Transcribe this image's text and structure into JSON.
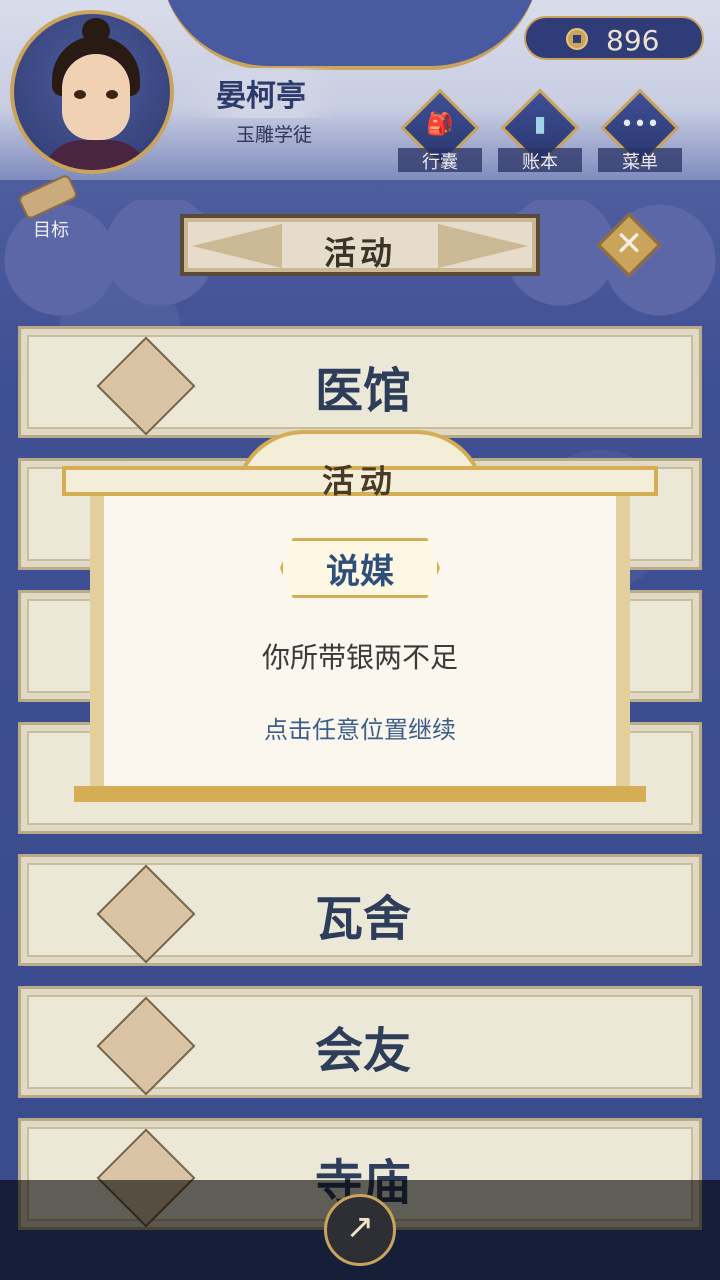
{
  "header": {
    "player_name": "晏柯亭",
    "player_rank": "玉雕学徒",
    "coins": "896",
    "buttons": [
      {
        "label": "行囊",
        "icon": "bag-icon"
      },
      {
        "label": "账本",
        "icon": "ledger-icon"
      },
      {
        "label": "菜单",
        "icon": "menu-dots-icon"
      }
    ],
    "goal_label": "目标"
  },
  "page": {
    "title": "活动",
    "close_icon": "close-icon"
  },
  "activities": [
    {
      "label": "医馆",
      "icon": "umbrella-flower-icon"
    },
    {
      "label": "",
      "icon": ""
    },
    {
      "label": "",
      "icon": ""
    },
    {
      "label": "",
      "icon": ""
    },
    {
      "label": "瓦舍",
      "icon": "lady-portrait-icon"
    },
    {
      "label": "会友",
      "icon": "tea-bowl-icon"
    },
    {
      "label": "寺庙",
      "icon": "incense-burner-icon"
    }
  ],
  "modal": {
    "title": "活动",
    "tag": "说媒",
    "message": "你所带银两不足",
    "hint": "点击任意位置继续"
  },
  "footer": {
    "share_icon": "share-icon"
  },
  "colors": {
    "accent_gold": "#c9a45a",
    "background_blue": "#3b4a8a",
    "text_dark_blue": "#2d3d5a"
  }
}
